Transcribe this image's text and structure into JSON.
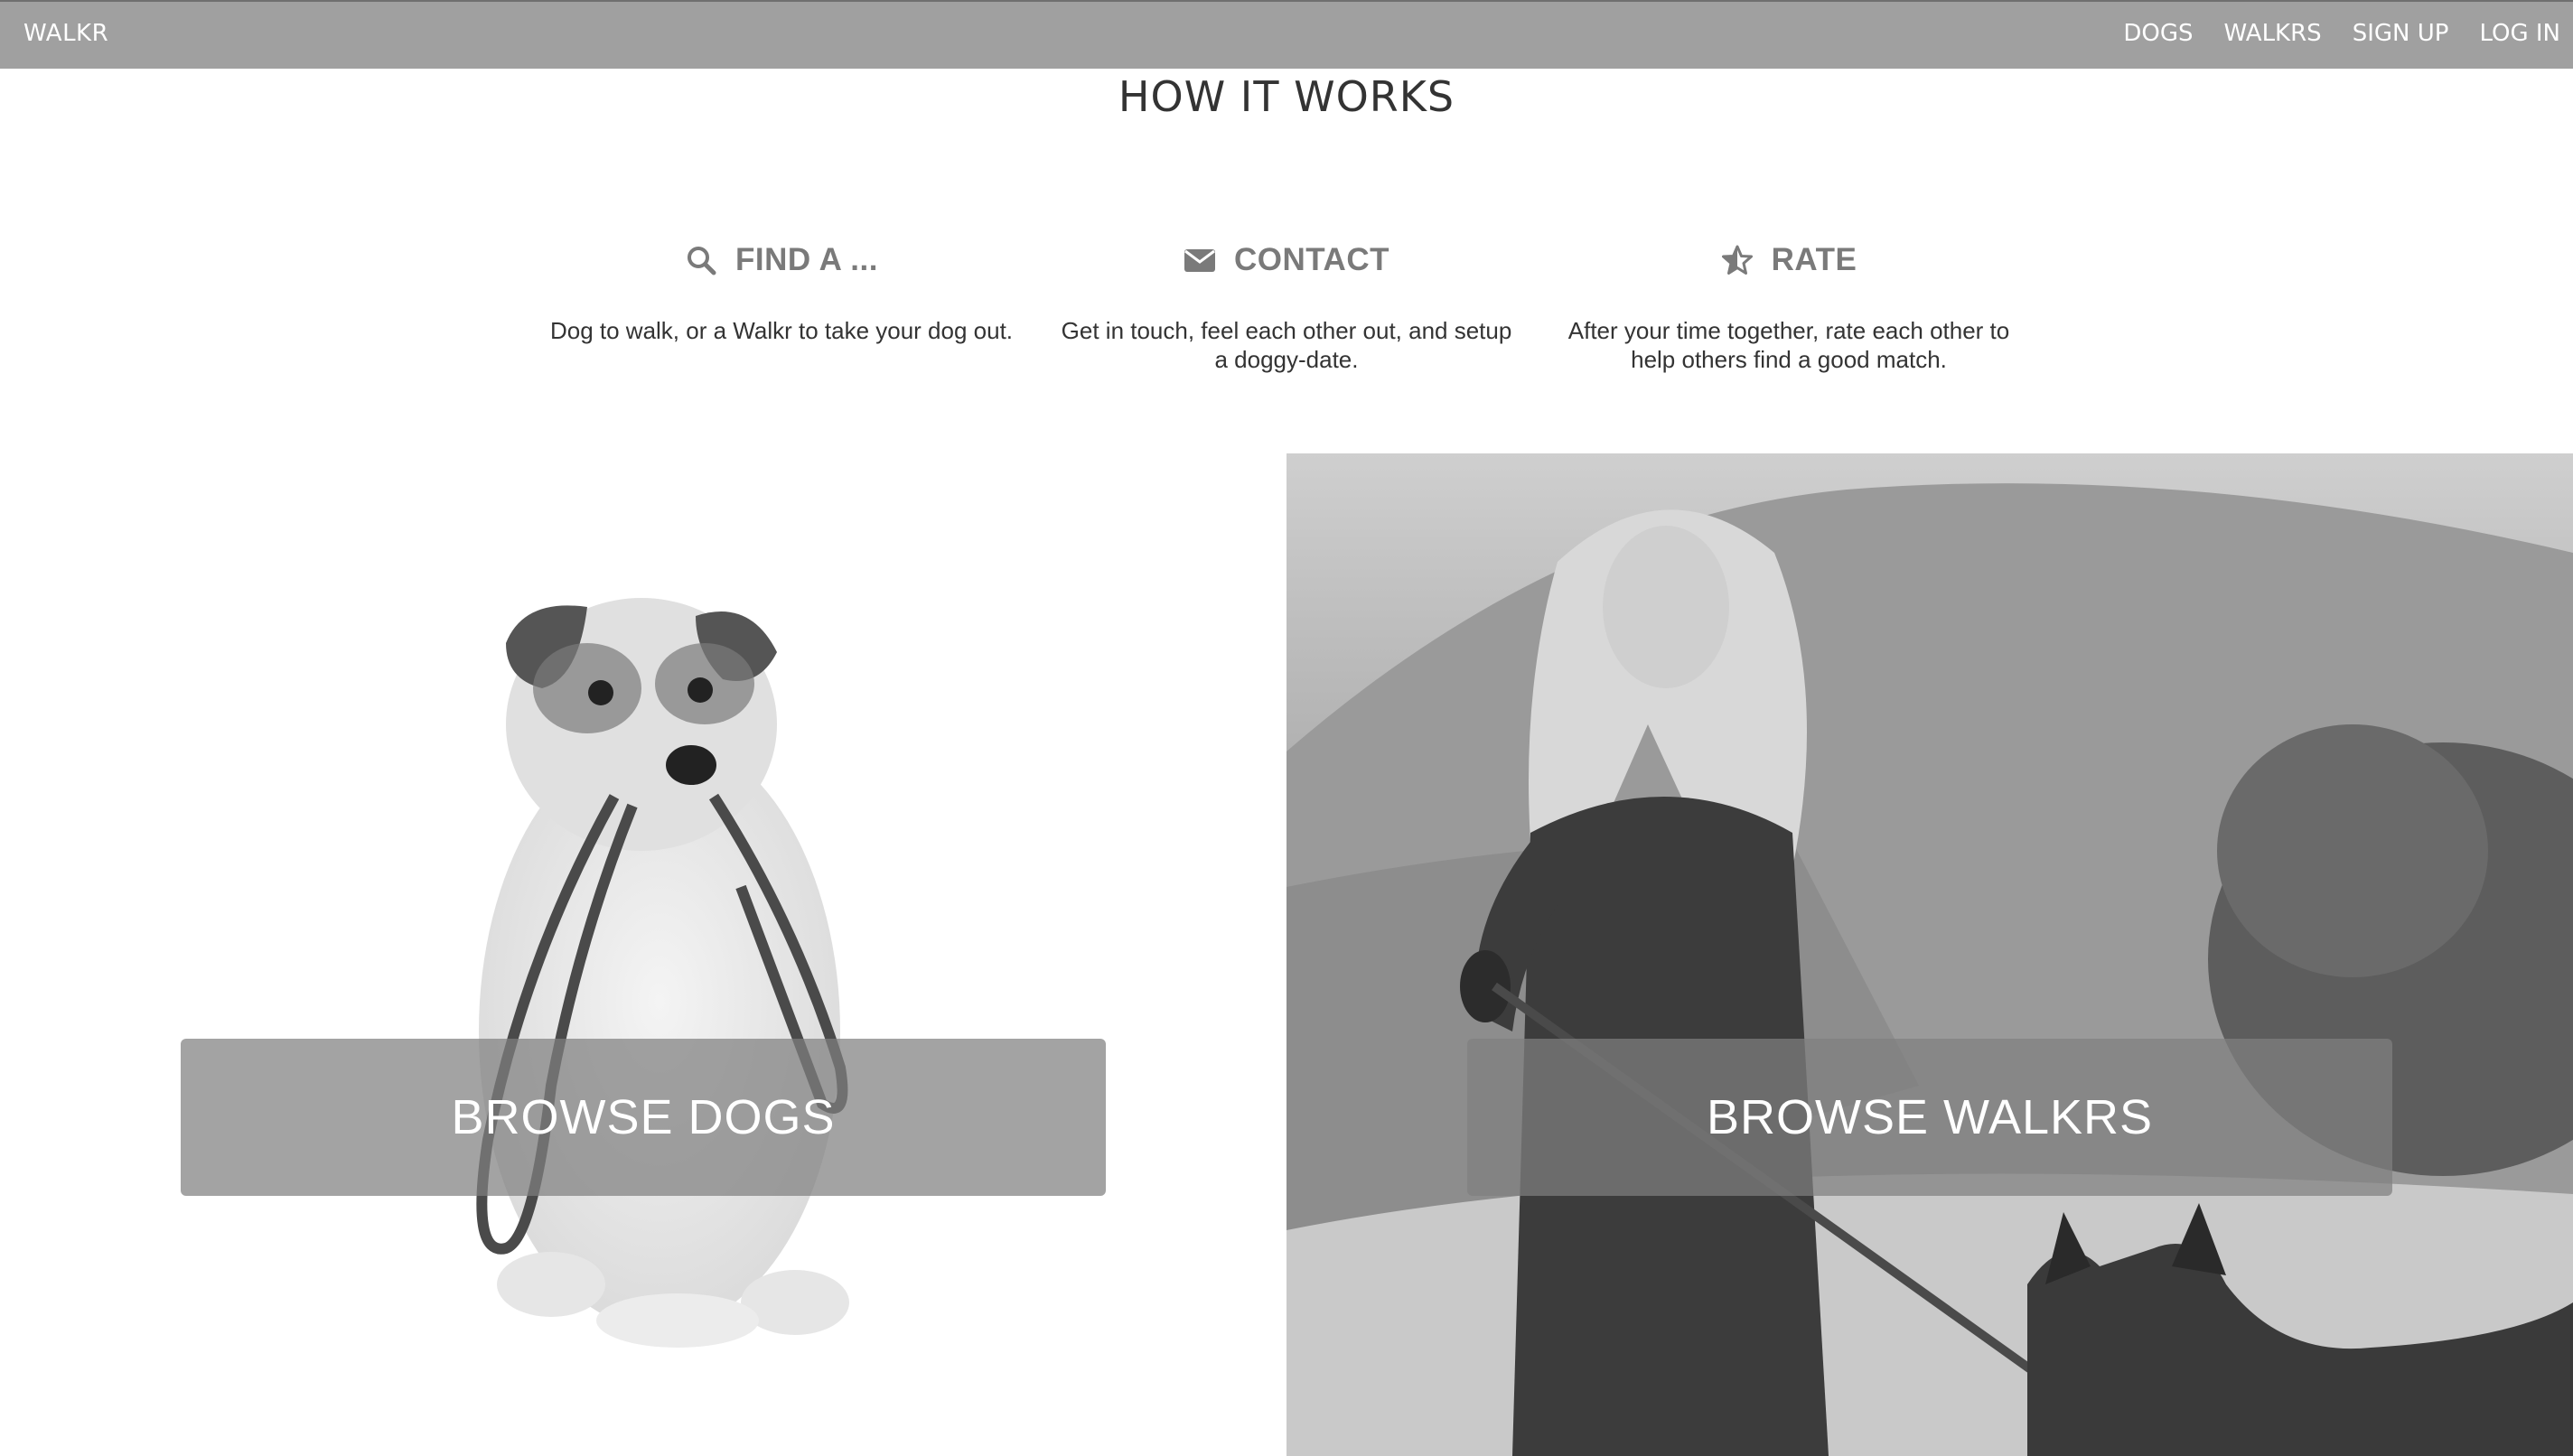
{
  "nav": {
    "brand": "WALKR",
    "links": [
      "DOGS",
      "WALKRS",
      "SIGN UP",
      "LOG IN"
    ]
  },
  "how_it_works": {
    "title": "HOW IT WORKS",
    "steps": [
      {
        "icon": "search-icon",
        "heading": "FIND A ...",
        "description": "Dog to walk, or a Walkr to take your dog out."
      },
      {
        "icon": "envelope-icon",
        "heading": "CONTACT",
        "description": "Get in touch, feel each other out, and setup a doggy-date."
      },
      {
        "icon": "star-icon",
        "heading": "RATE",
        "description": "After your time together, rate each other to help others find a good match."
      }
    ]
  },
  "panels": {
    "dogs": {
      "image": "dog-with-leash-photo",
      "button_label": "BROWSE DOGS"
    },
    "walkrs": {
      "image": "woman-walking-dog-photo",
      "button_label": "BROWSE WALKRS"
    }
  },
  "colors": {
    "navbar": "#a0a0a0",
    "heading_gray": "#7a7a7a",
    "button_overlay": "#808080"
  }
}
